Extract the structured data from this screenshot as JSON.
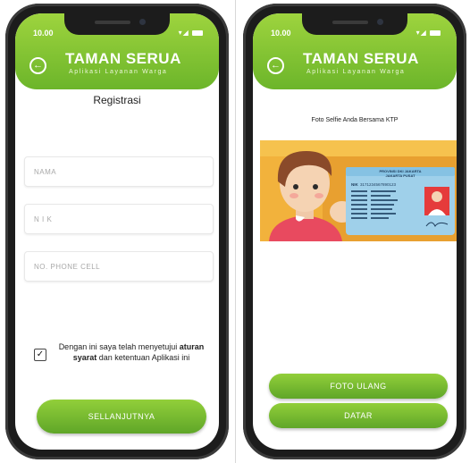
{
  "status_bar": {
    "time": "10.00",
    "icons": [
      "wifi-icon",
      "signal-icon",
      "battery-icon"
    ]
  },
  "header": {
    "title": "TAMAN SERUA",
    "subtitle": "Aplikasi Layanan Warga"
  },
  "registration": {
    "page_title": "Registrasi",
    "fields": {
      "name_placeholder": "NAMA",
      "nik_placeholder": "N I K",
      "phone_placeholder": "NO. PHONE CELL"
    },
    "agreement": {
      "checked": true,
      "text_before": "Dengan ini saya telah menyetujui ",
      "bold_1": "aturan",
      "bold_2": "syarat",
      "text_after": " dan ketentuan Aplikasi ini"
    },
    "next_button": "SELLANJUTNYA"
  },
  "selfie": {
    "caption": "Foto Selfie Anda Bersama KTP",
    "retake_button": "FOTO ULANG",
    "list_button": "DATAR"
  },
  "ktp_card": {
    "province": "PROVINSI DKI JAKARTA",
    "city": "JAKARTA PUSAT",
    "nik_label": "NIK",
    "nik": "3171234567890123"
  },
  "colors": {
    "accent_top": "#9ed43e",
    "accent_bottom": "#6cb52a",
    "phone_frame": "#1c1c1c"
  }
}
